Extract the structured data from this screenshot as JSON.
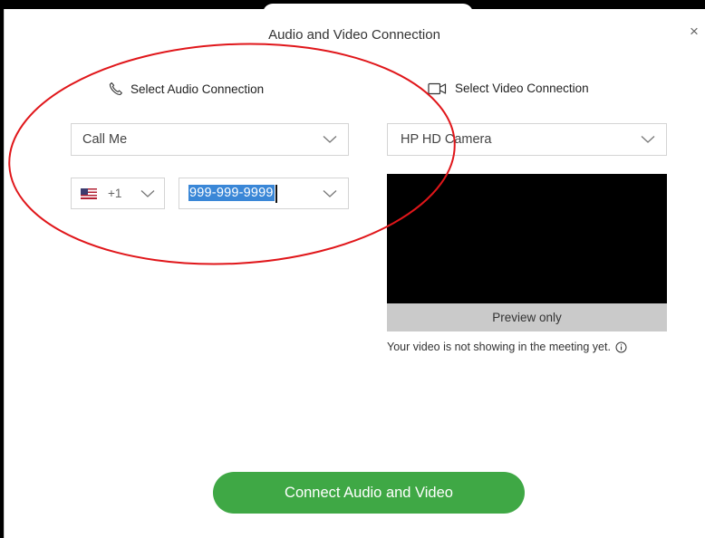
{
  "dialog": {
    "title": "Audio and Video Connection",
    "close_label": "×"
  },
  "audio": {
    "heading": "Select Audio Connection",
    "connection_value": "Call Me",
    "country_code": "+1",
    "phone_value": "999-999-9999"
  },
  "video": {
    "heading": "Select Video Connection",
    "camera_value": "HP HD Camera",
    "preview_label": "Preview only",
    "notice": "Your video is not showing in the meeting yet."
  },
  "actions": {
    "connect_label": "Connect Audio and Video"
  },
  "colors": {
    "connect_button": "#3fa845",
    "selection_highlight": "#3a87d7",
    "annotation_ring": "#e0161a"
  },
  "icons": {
    "audio_heading": "phone-icon",
    "video_heading": "video-camera-icon",
    "dropdown": "chevron-down-icon",
    "country": "us-flag-icon",
    "notice": "info-icon"
  }
}
